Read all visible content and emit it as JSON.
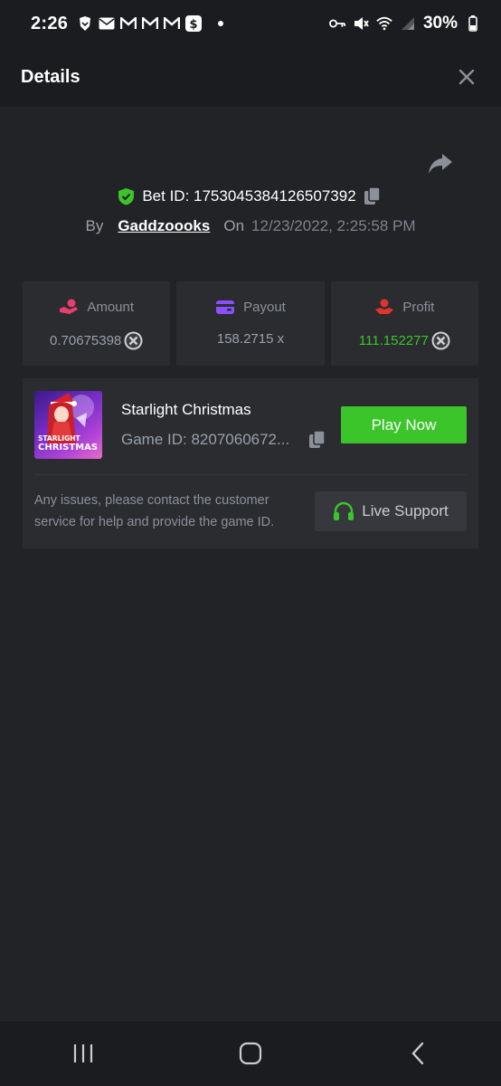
{
  "status_bar": {
    "time": "2:26",
    "battery": "30%"
  },
  "header": {
    "title": "Details"
  },
  "bet": {
    "bet_id_label": "Bet ID: 1753045384126507392",
    "by_label": "By",
    "username": "Gaddzoooks",
    "on_label": "On",
    "date": "12/23/2022, 2:25:58 PM"
  },
  "stats": [
    {
      "label": "Amount",
      "value": "0.70675398",
      "icon": "money-hand-icon",
      "color": "#e83e6f"
    },
    {
      "label": "Payout",
      "value": "158.2715 x",
      "icon": "wallet-card-icon",
      "color": "#8a4fff"
    },
    {
      "label": "Profit",
      "value": "111.152277",
      "icon": "profit-hand-icon",
      "color": "#e0342f"
    }
  ],
  "game": {
    "name": "Starlight Christmas",
    "id_text": "Game ID: 8207060672...",
    "thumb_text_1": "STARLIGHT",
    "thumb_text_2": "CHRISTMAS",
    "play_label": "Play Now"
  },
  "support": {
    "text": "Any issues, please contact the customer service for help and provide the game ID.",
    "button_label": "Live Support"
  },
  "colors": {
    "accent_green": "#3cc42b",
    "background": "#222326",
    "card": "#2a2c30"
  }
}
